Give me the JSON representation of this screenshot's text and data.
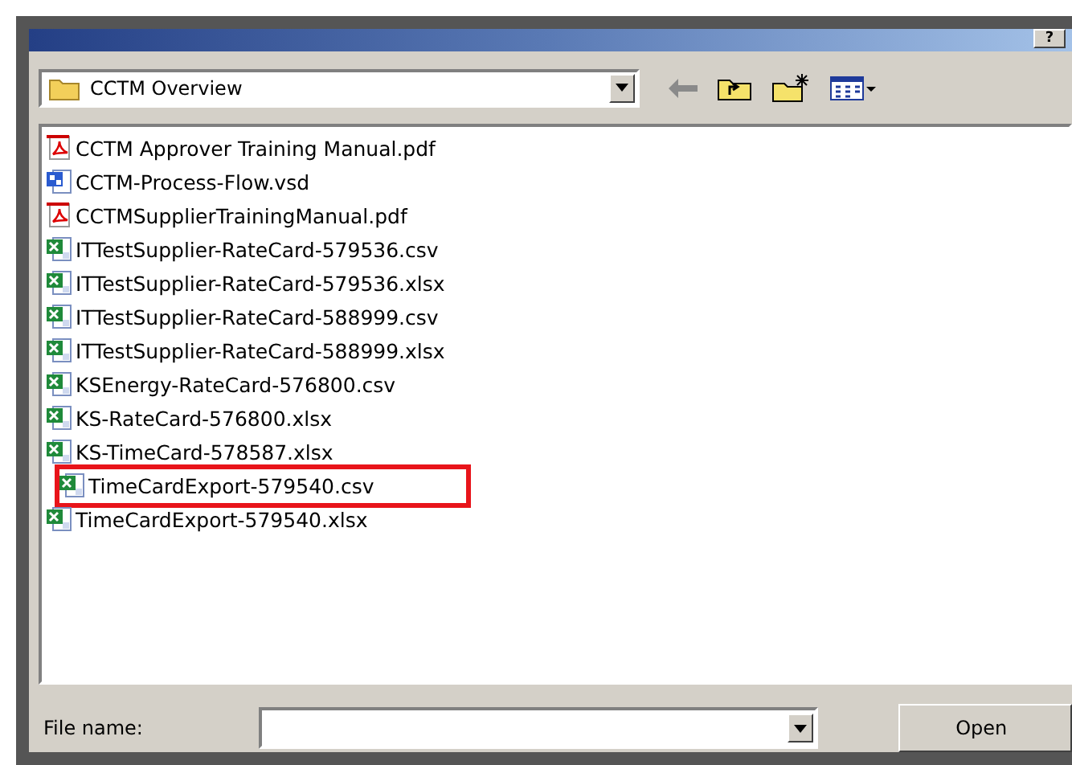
{
  "title_bar": {
    "help_button": "?"
  },
  "look_in": {
    "value": "CCTM Overview"
  },
  "files": [
    {
      "name": "CCTM Approver Training Manual.pdf",
      "kind": "pdf",
      "highlighted": false
    },
    {
      "name": "CCTM-Process-Flow.vsd",
      "kind": "visio",
      "highlighted": false
    },
    {
      "name": "CCTMSupplierTrainingManual.pdf",
      "kind": "pdf",
      "highlighted": false
    },
    {
      "name": "ITTestSupplier-RateCard-579536.csv",
      "kind": "spreadsheet",
      "highlighted": false
    },
    {
      "name": "ITTestSupplier-RateCard-579536.xlsx",
      "kind": "spreadsheet",
      "highlighted": false
    },
    {
      "name": "ITTestSupplier-RateCard-588999.csv",
      "kind": "spreadsheet",
      "highlighted": false
    },
    {
      "name": "ITTestSupplier-RateCard-588999.xlsx",
      "kind": "spreadsheet",
      "highlighted": false
    },
    {
      "name": "KSEnergy-RateCard-576800.csv",
      "kind": "spreadsheet",
      "highlighted": false
    },
    {
      "name": "KS-RateCard-576800.xlsx",
      "kind": "spreadsheet",
      "highlighted": false
    },
    {
      "name": "KS-TimeCard-578587.xlsx",
      "kind": "spreadsheet",
      "highlighted": false
    },
    {
      "name": "TimeCardExport-579540.csv",
      "kind": "spreadsheet",
      "highlighted": true
    },
    {
      "name": "TimeCardExport-579540.xlsx",
      "kind": "spreadsheet",
      "highlighted": false
    }
  ],
  "file_name": {
    "label": "File name:"
  },
  "open_button": "Open"
}
